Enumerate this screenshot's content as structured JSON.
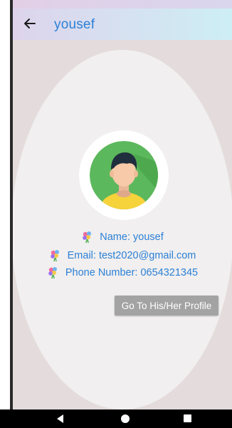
{
  "appbar": {
    "title": "yousef",
    "back_icon": "arrow-left-icon"
  },
  "user_info": {
    "name": "Name: yousef",
    "email": "Email: test2020@gmail.com",
    "phone": "Phone Number: 0654321345",
    "item_icon": "flower-bouquet-icon"
  },
  "actions": {
    "profile_button": "Go To His/Her Profile"
  },
  "navbar": {
    "back_icon": "nav-back-icon",
    "home_icon": "nav-home-icon",
    "recents_icon": "nav-recents-icon"
  },
  "colors": {
    "accent": "#2c80d6",
    "button": "#a3a3a3",
    "avatar_bg": "#5cb85c",
    "shirt": "#f6d23b",
    "card": "#e4dcdc",
    "oval": "#f1efef"
  }
}
